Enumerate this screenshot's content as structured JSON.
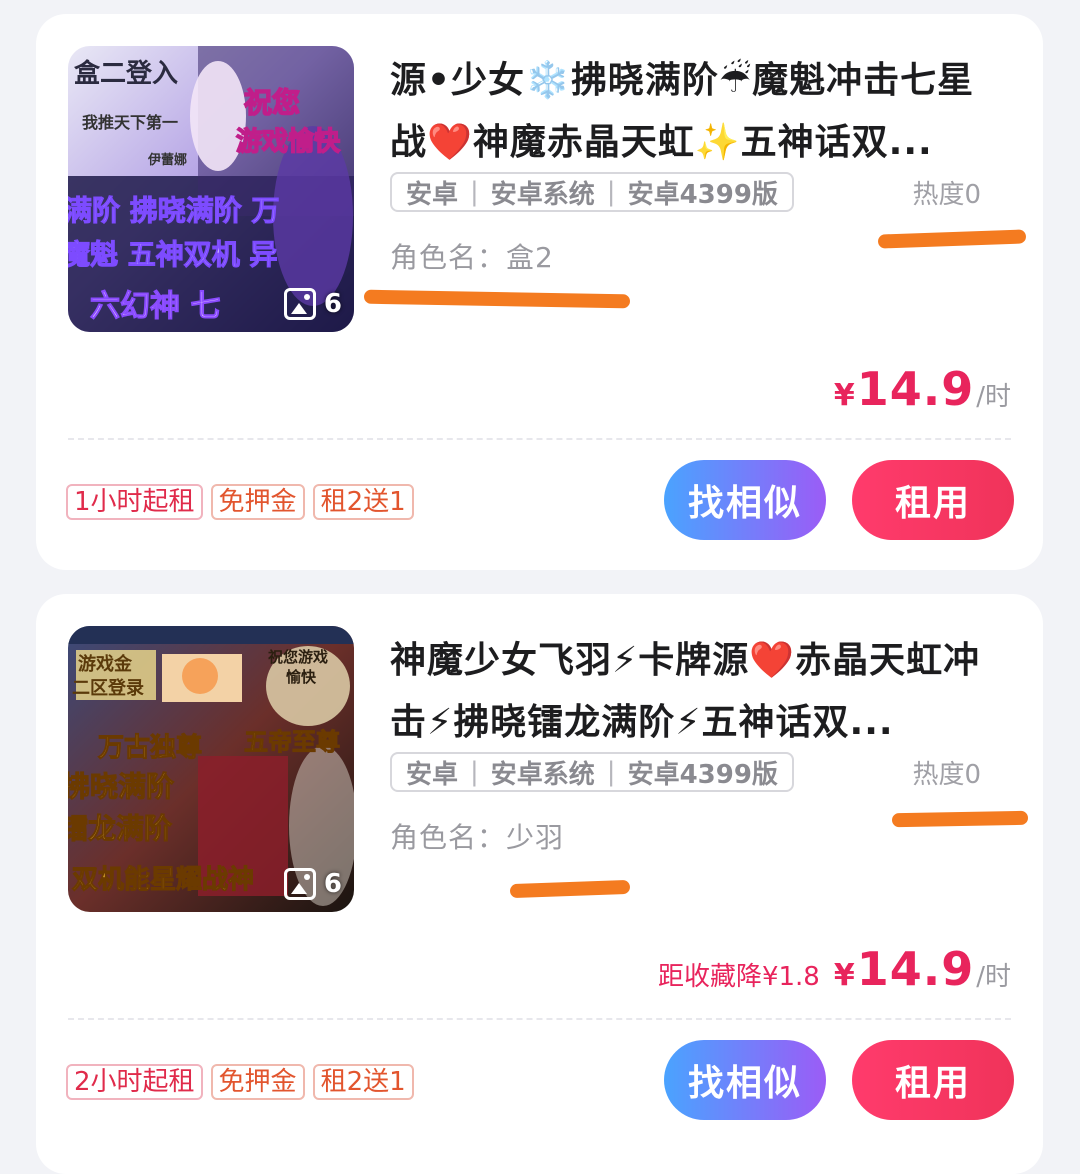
{
  "listings": [
    {
      "title": "源•少女❄️拂晓满阶☔魔魁冲击七星战❤️神魔赤晶天虹✨五神话双...",
      "platform": [
        "安卓",
        "安卓系统",
        "安卓4399版"
      ],
      "heat": "热度0",
      "role_label": "角色名：",
      "role_value": "盒2",
      "image_count": "6",
      "thumb_texts": [
        "盒二登入",
        "我推天下第一",
        "伊蕾娜",
        "祝您",
        "游戏愉快",
        "满阶 拂晓满阶 万",
        "魔魁 五神双机 异",
        "六幻神 七"
      ],
      "price_drop": "",
      "currency": "¥",
      "price": "14.9",
      "price_unit": "/时",
      "tags": [
        "1小时起租",
        "免押金",
        "租2送1"
      ],
      "similar_label": "找相似",
      "rent_label": "租用"
    },
    {
      "title": "神魔少女飞羽⚡卡牌源❤️赤晶天虹冲击⚡拂晓镭龙满阶⚡五神话双...",
      "platform": [
        "安卓",
        "安卓系统",
        "安卓4399版"
      ],
      "heat": "热度0",
      "role_label": "角色名：",
      "role_value": "少羽",
      "image_count": "6",
      "thumb_texts": [
        "游戏金",
        "二区登录",
        "祝您游戏",
        "愉快",
        "万古独尊",
        "五帝至尊",
        "拂晓满阶",
        "镭龙满阶",
        "双机能星耀战神"
      ],
      "price_drop": "距收藏降¥1.8",
      "currency": "¥",
      "price": "14.9",
      "price_unit": "/时",
      "tags": [
        "2小时起租",
        "免押金",
        "租2送1"
      ],
      "similar_label": "找相似",
      "rent_label": "租用"
    }
  ],
  "colors": {
    "price": "#e8245c",
    "annotation_marker": "#f47b20",
    "similar_button_gradient": [
      "#4aa3ff",
      "#9b5cf6"
    ],
    "rent_button_gradient": [
      "#ff3b6c",
      "#f0335a"
    ]
  },
  "icons": {
    "image_count": "image-icon"
  }
}
